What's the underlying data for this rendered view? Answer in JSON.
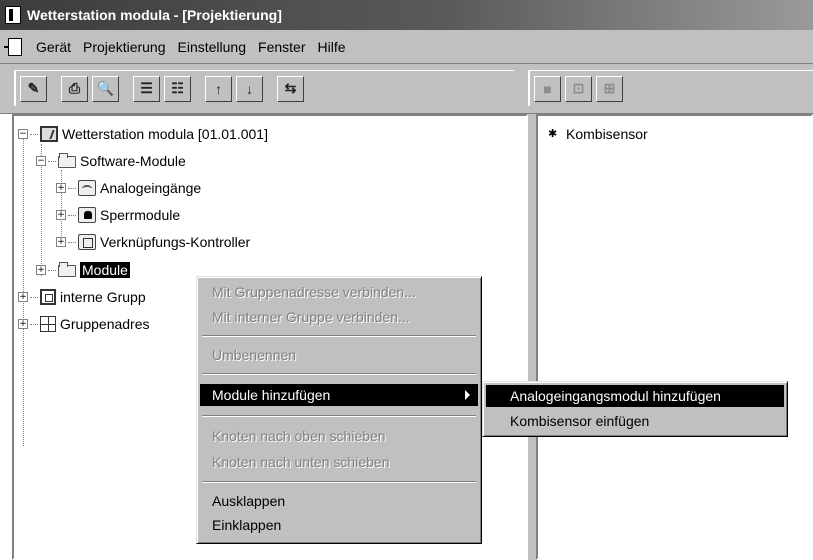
{
  "window": {
    "title": "Wetterstation modula - [Projektierung]"
  },
  "menubar": {
    "items": [
      "Gerät",
      "Projektierung",
      "Einstellung",
      "Fenster",
      "Hilfe"
    ]
  },
  "toolbar": {
    "left_buttons": [
      {
        "name": "edit-icon",
        "glyph": "✎"
      },
      {
        "name": "printer-icon",
        "glyph": "⎙"
      },
      {
        "name": "print-preview-icon",
        "glyph": "🔍"
      },
      {
        "name": "list-icon",
        "glyph": "☰"
      },
      {
        "name": "tree-list-icon",
        "glyph": "☷"
      },
      {
        "name": "arrow-up-icon",
        "glyph": "↑"
      },
      {
        "name": "arrow-down-icon",
        "glyph": "↓"
      },
      {
        "name": "transfer-icon",
        "glyph": "⇆"
      }
    ],
    "right_buttons": [
      {
        "name": "lock-icon",
        "glyph": "■"
      },
      {
        "name": "connect-icon",
        "glyph": "⊡"
      },
      {
        "name": "insert-icon",
        "glyph": "⊞"
      }
    ]
  },
  "tree": {
    "root": "Wetterstation modula [01.01.001]",
    "software_modules": "Software-Module",
    "analog_inputs": "Analogeingänge",
    "lock_modules": "Sperrmodule",
    "logic_controller": "Verknüpfungs-Kontroller",
    "modules": "Module",
    "internal_groups": "interne Grupp",
    "group_addresses": "Gruppenadres"
  },
  "right_panel": {
    "item": "Kombisensor"
  },
  "context_menu": {
    "connect_group_address": "Mit Gruppenadresse verbinden...",
    "connect_internal_group": "Mit interner Gruppe verbinden...",
    "rename": "Umbenennen",
    "add_modules": "Module hinzufügen",
    "move_up": "Knoten nach oben schieben",
    "move_down": "Knoten nach unten schieben",
    "expand": "Ausklappen",
    "collapse": "Einklappen"
  },
  "submenu": {
    "add_analog_module": "Analogeingangsmodul hinzufügen",
    "insert_kombisensor": "Kombisensor einfügen"
  }
}
